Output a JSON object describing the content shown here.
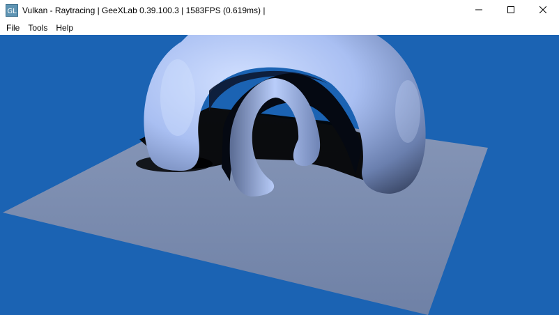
{
  "window": {
    "title": "Vulkan - Raytracing | GeeXLab 0.39.100.3 | 1583FPS (0.619ms) |",
    "app_icon": "geexlab-logo-icon",
    "controls": [
      "minimize-icon",
      "maximize-icon",
      "close-icon"
    ]
  },
  "menu": {
    "items": [
      {
        "label": "File"
      },
      {
        "label": "Tools"
      },
      {
        "label": "Help"
      }
    ]
  },
  "viewport": {
    "scene": "raytraced-tori-on-plane",
    "colors": {
      "background": "#1b63b3",
      "plane": "#7b8db0",
      "torus_light": "#c0d4ff",
      "torus_dark": "#3a4766",
      "shadow": "#000000"
    }
  }
}
